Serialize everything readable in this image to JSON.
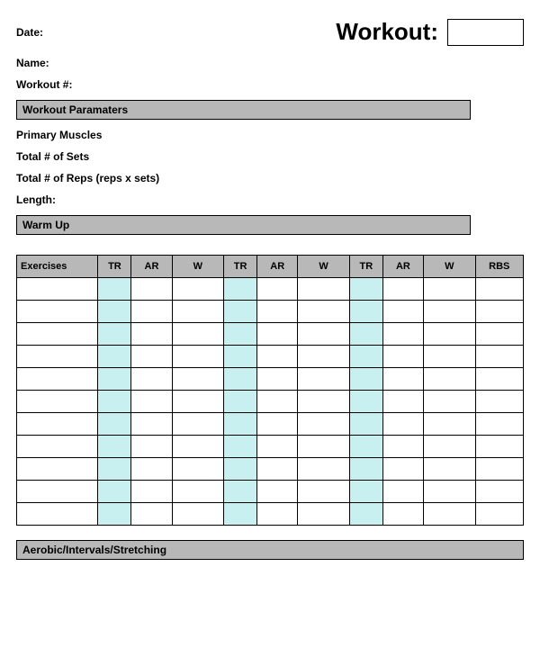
{
  "header": {
    "date_label": "Date:",
    "workout_title": "Workout:",
    "name_label": "Name:",
    "workout_number_label": "Workout #:"
  },
  "sections": {
    "parameters": "Workout Paramaters",
    "warm_up": "Warm Up",
    "aerobic": "Aerobic/Intervals/Stretching"
  },
  "parameters": {
    "primary_muscles": "Primary Muscles",
    "total_sets": "Total # of Sets",
    "total_reps": "Total # of Reps (reps x sets)",
    "length": "Length:"
  },
  "table": {
    "headers": [
      "Exercises",
      "TR",
      "AR",
      "W",
      "TR",
      "AR",
      "W",
      "TR",
      "AR",
      "W",
      "RBS"
    ],
    "row_count": 11,
    "tr_columns": [
      1,
      4,
      7
    ]
  }
}
